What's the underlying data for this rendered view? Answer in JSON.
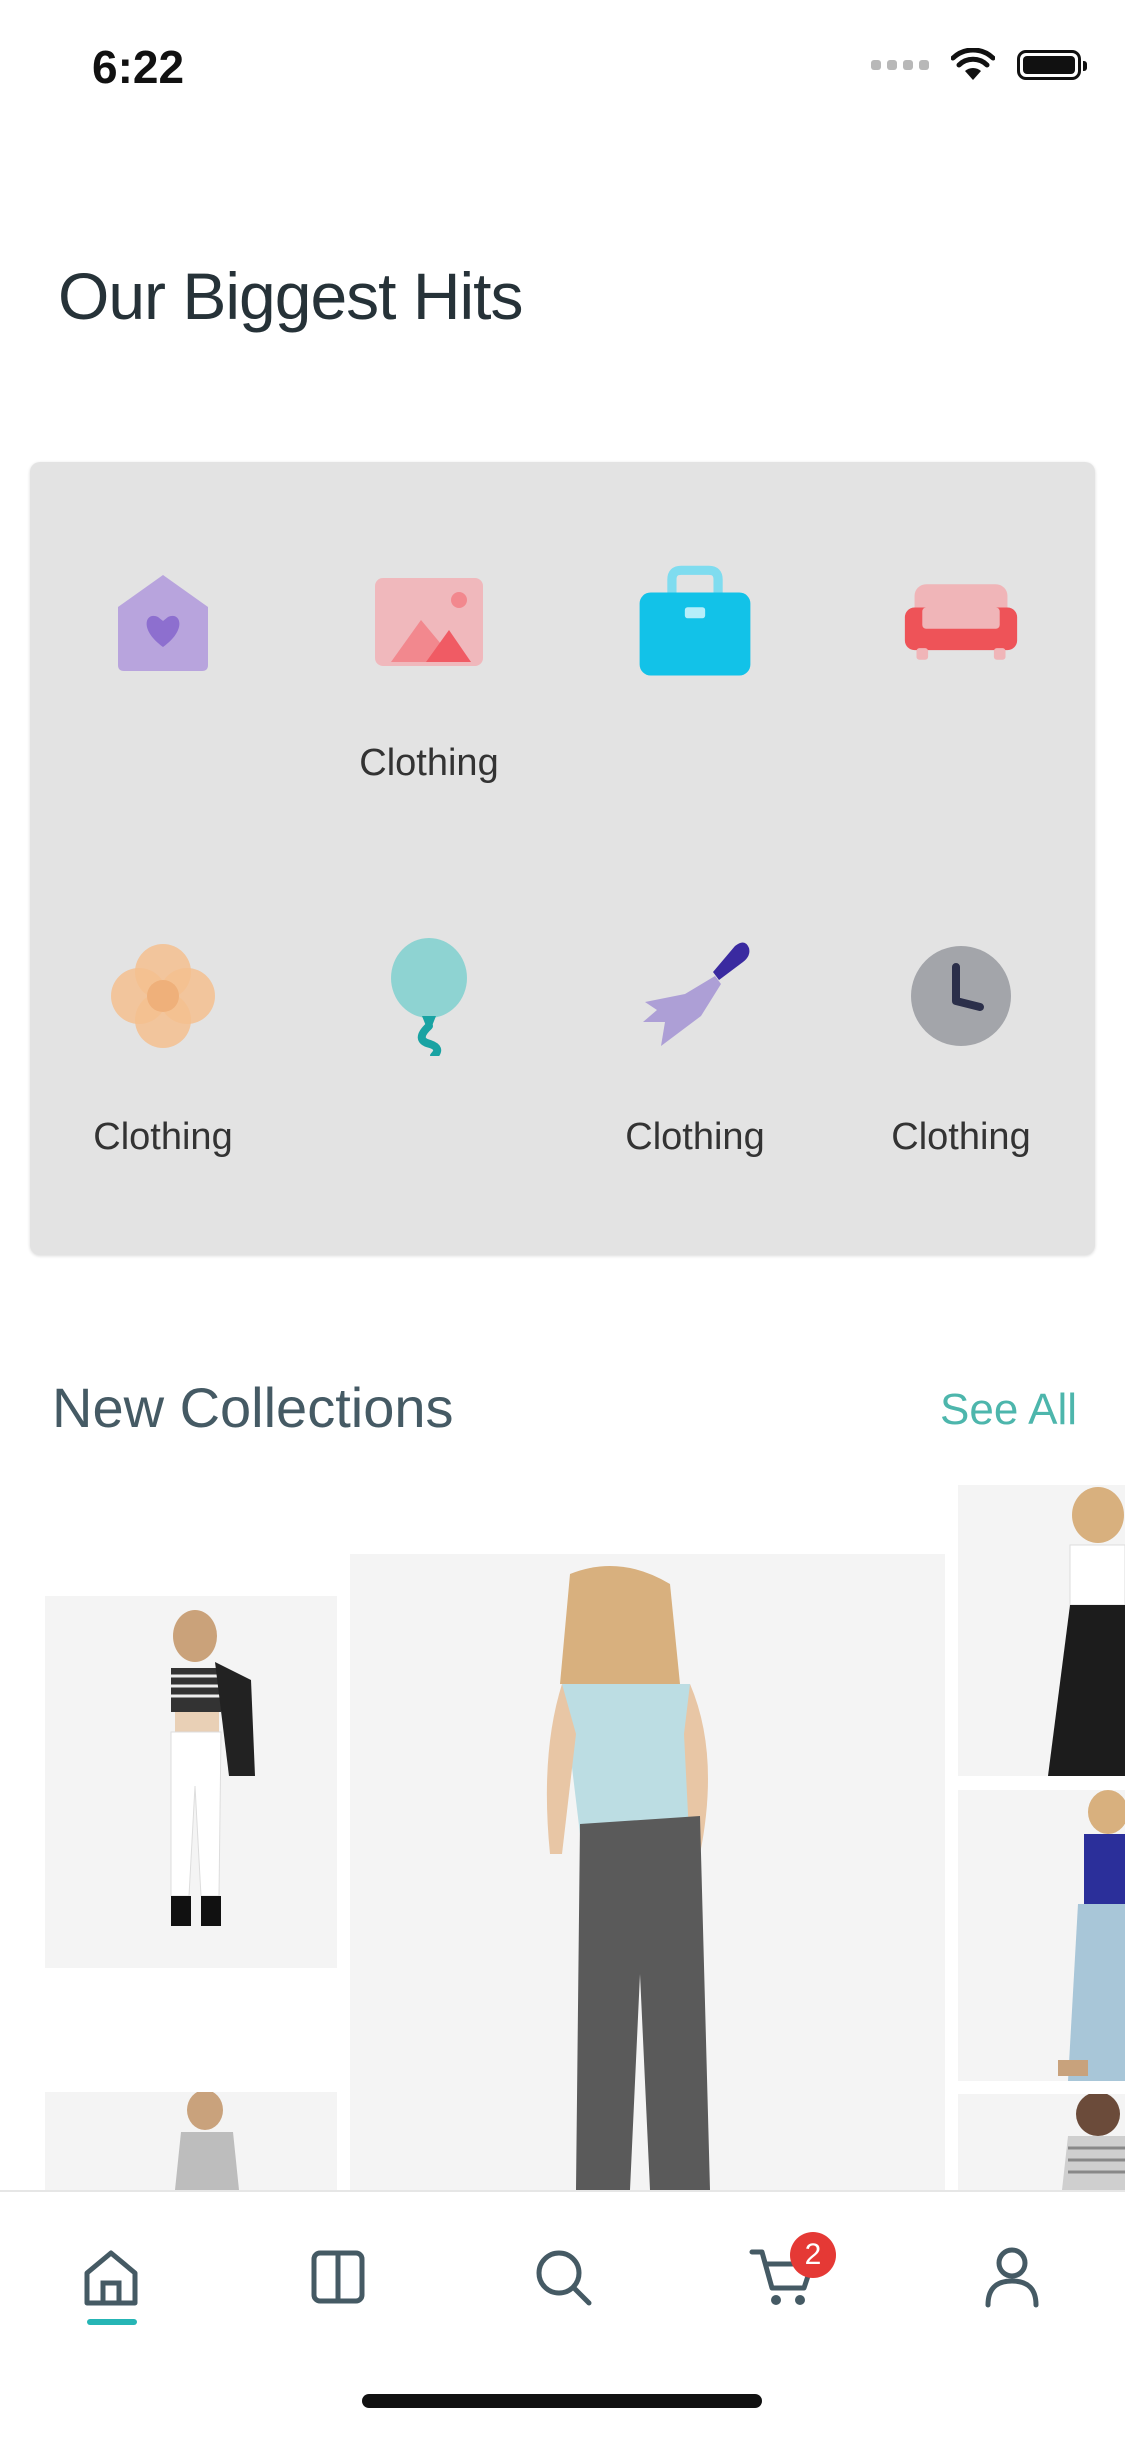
{
  "status_bar": {
    "time": "6:22"
  },
  "page": {
    "title": "Our Biggest Hits"
  },
  "categories": [
    {
      "icon": "envelope-heart-icon",
      "label": ""
    },
    {
      "icon": "image-icon",
      "label": "Clothing"
    },
    {
      "icon": "shopping-bag-icon",
      "label": ""
    },
    {
      "icon": "sofa-icon",
      "label": ""
    },
    {
      "icon": "flower-icon",
      "label": "Clothing"
    },
    {
      "icon": "balloon-icon",
      "label": ""
    },
    {
      "icon": "brush-icon",
      "label": "Clothing"
    },
    {
      "icon": "clock-icon",
      "label": "Clothing"
    }
  ],
  "collections": {
    "title": "New Collections",
    "see_all": "See All"
  },
  "tabbar": {
    "items": [
      "home-icon",
      "catalog-icon",
      "search-icon",
      "cart-icon",
      "profile-icon"
    ],
    "cart_badge": "2",
    "accent": "#26b5b5"
  },
  "colors": {
    "badge": "#e53935",
    "see_all": "#4db6ac",
    "panel": "#e3e3e3"
  }
}
